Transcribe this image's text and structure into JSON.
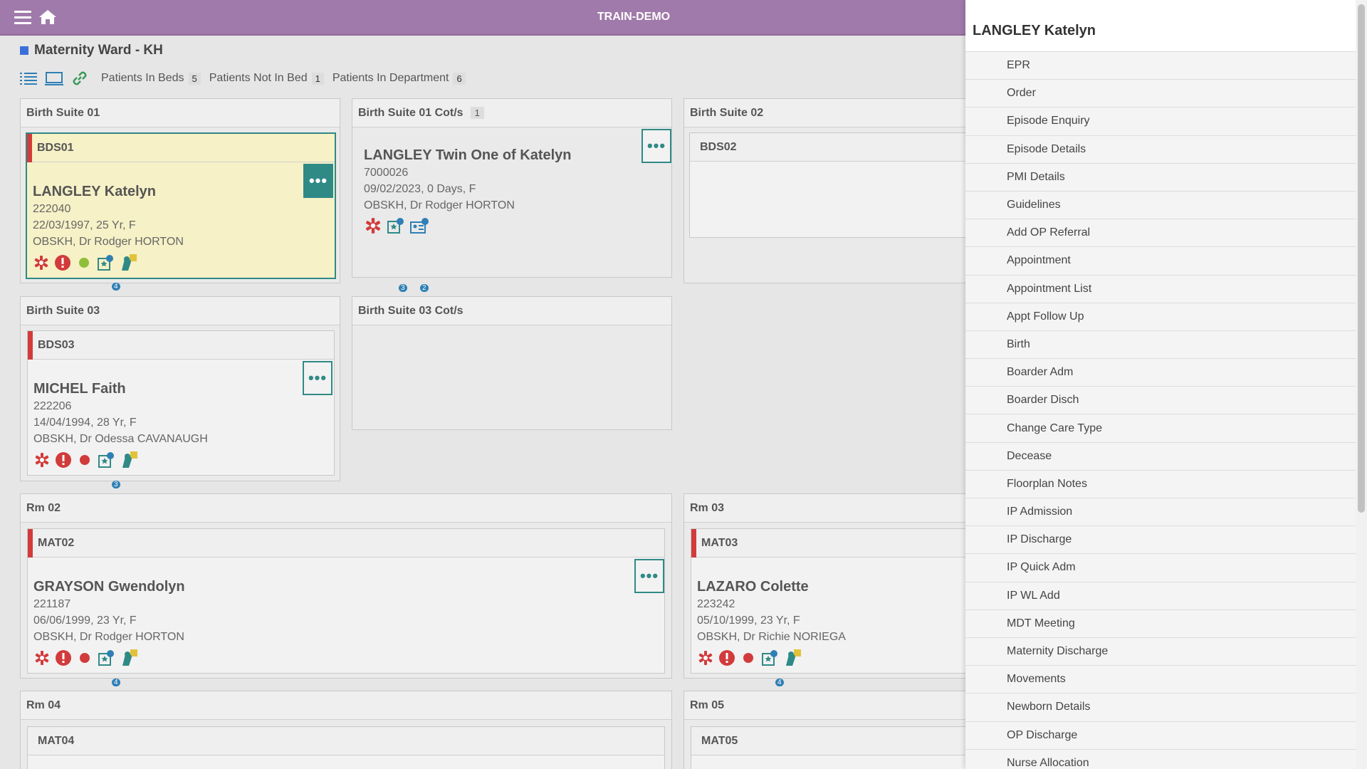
{
  "app": {
    "env_title": "TRAIN-DEMO"
  },
  "ward": {
    "title": "Maternity Ward - KH",
    "tabs": [
      {
        "label": "Patients In Beds",
        "count": "5"
      },
      {
        "label": "Patients Not In Bed",
        "count": "1"
      },
      {
        "label": "Patients In Department",
        "count": "6"
      }
    ]
  },
  "rooms": {
    "bs01": {
      "title": "Birth Suite 01"
    },
    "bs01cot": {
      "title": "Birth Suite 01 Cot/s",
      "count": "1"
    },
    "bs02": {
      "title": "Birth Suite 02"
    },
    "bs03": {
      "title": "Birth Suite 03"
    },
    "bs03cot": {
      "title": "Birth Suite 03 Cot/s"
    },
    "rm02": {
      "title": "Rm 02"
    },
    "rm03": {
      "title": "Rm 03"
    },
    "rm04": {
      "title": "Rm 04"
    },
    "rm05": {
      "title": "Rm 05"
    }
  },
  "beds": {
    "bds01": {
      "label": "BDS01",
      "name": "LANGLEY Katelyn",
      "id": "222040",
      "dob": "22/03/1997, 25 Yr, F",
      "consultant": "OBSKH, Dr Rodger HORTON",
      "badge": "4"
    },
    "twin": {
      "name": "LANGLEY Twin One of Katelyn",
      "id": "7000026",
      "dob": "09/02/2023, 0 Days, F",
      "consultant": "OBSKH, Dr Rodger HORTON",
      "badge1": "3",
      "badge2": "2"
    },
    "bds02": {
      "label": "BDS02"
    },
    "bds03": {
      "label": "BDS03",
      "name": "MICHEL Faith",
      "id": "222206",
      "dob": "14/04/1994, 28 Yr, F",
      "consultant": "OBSKH, Dr Odessa CAVANAUGH",
      "badge": "3"
    },
    "mat02": {
      "label": "MAT02",
      "name": "GRAYSON Gwendolyn",
      "id": "221187",
      "dob": "06/06/1999, 23 Yr, F",
      "consultant": "OBSKH, Dr Rodger HORTON",
      "badge": "4"
    },
    "mat03": {
      "label": "MAT03",
      "name": "LAZARO Colette",
      "id": "223242",
      "dob": "05/10/1999, 23 Yr, F",
      "consultant": "OBSKH, Dr Richie NORIEGA",
      "badge": "4"
    },
    "mat04": {
      "label": "MAT04"
    },
    "mat05": {
      "label": "MAT05"
    }
  },
  "panel": {
    "title": "LANGLEY Katelyn",
    "items": [
      "EPR",
      "Order",
      "Episode Enquiry",
      "Episode Details",
      "PMI Details",
      "Guidelines",
      "Add OP Referral",
      "Appointment",
      "Appointment List",
      "Appt Follow Up",
      "Birth",
      "Boarder Adm",
      "Boarder Disch",
      "Change Care Type",
      "Decease",
      "Floorplan Notes",
      "IP Admission",
      "IP Discharge",
      "IP Quick Adm",
      "IP WL Add",
      "MDT Meeting",
      "Maternity Discharge",
      "Movements",
      "Newborn Details",
      "OP Discharge",
      "Nurse Allocation"
    ]
  },
  "colors": {
    "topbar": "#a07aaa",
    "accent": "#2f8a86",
    "alert": "#d23b3b",
    "selected_bed": "#f6f1c6"
  }
}
